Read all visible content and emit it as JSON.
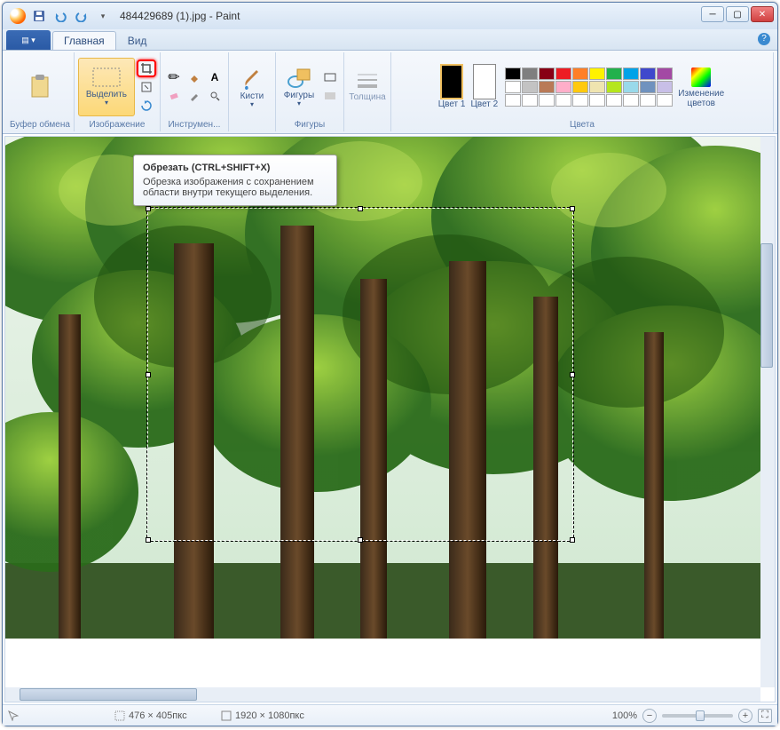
{
  "title": "484429689 (1).jpg - Paint",
  "tabs": {
    "main": "Главная",
    "view": "Вид"
  },
  "ribbon": {
    "clipboard": {
      "label": "Буфер обмена",
      "paste": "Вставить"
    },
    "image": {
      "label": "Изображение",
      "select": "Выделить"
    },
    "tools": {
      "label": "Инструмен..."
    },
    "brushes": {
      "label": "Кисти"
    },
    "shapes": {
      "label": "Фигуры",
      "btn": "Фигуры"
    },
    "thickness": {
      "label": "Толщина"
    },
    "colors": {
      "label": "Цвета",
      "c1": "Цвет 1",
      "c2": "Цвет 2",
      "edit": "Изменение цветов"
    }
  },
  "tooltip": {
    "title": "Обрезать (CTRL+SHIFT+X)",
    "body": "Обрезка изображения с сохранением области внутри текущего выделения."
  },
  "status": {
    "selection_size": "476 × 405пкс",
    "image_size": "1920 × 1080пкс",
    "zoom": "100%"
  },
  "palette_colors": [
    "#000000",
    "#7f7f7f",
    "#880015",
    "#ed1c24",
    "#ff7f27",
    "#fff200",
    "#22b14c",
    "#00a2e8",
    "#3f48cc",
    "#a349a4",
    "#ffffff",
    "#c3c3c3",
    "#b97a57",
    "#ffaec9",
    "#ffc90e",
    "#efe4b0",
    "#b5e61d",
    "#99d9ea",
    "#7092be",
    "#c8bfe7",
    "#ffffff",
    "#ffffff",
    "#ffffff",
    "#ffffff",
    "#ffffff",
    "#ffffff",
    "#ffffff",
    "#ffffff",
    "#ffffff",
    "#ffffff"
  ]
}
